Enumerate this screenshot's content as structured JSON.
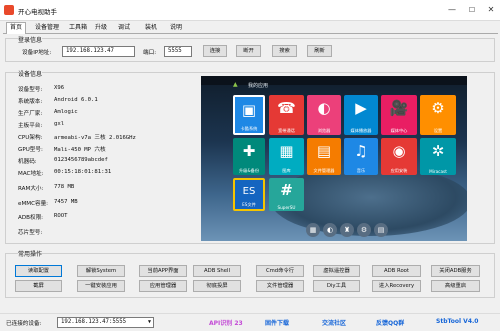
{
  "window": {
    "title": "开心电视助手",
    "minimize": "—",
    "maximize": "☐",
    "close": "✕"
  },
  "tabs": [
    "首页",
    "设备管理",
    "工具箱",
    "升级",
    "调试",
    "装机",
    "说明"
  ],
  "login": {
    "group_title": "登录信息",
    "ip_label": "设备IP地址:",
    "ip_value": "192.168.123.47",
    "port_label": "端口:",
    "port_value": "5555",
    "connect": "连接",
    "disconnect": "断开",
    "search": "搜索",
    "refresh": "刷新"
  },
  "device": {
    "group_title": "设备信息",
    "rows": [
      {
        "label": "设备型号:",
        "value": "X96"
      },
      {
        "label": "系统版本:",
        "value": "Android 6.0.1"
      },
      {
        "label": "生产厂家:",
        "value": "Amlogic"
      },
      {
        "label": "主板平台:",
        "value": "gxl"
      },
      {
        "label": "CPU架构:",
        "value": "armeabi-v7a 三核 2.016GHz"
      },
      {
        "label": "GPU型号:",
        "value": "Mali-450 MP 六核"
      },
      {
        "label": "机器码:",
        "value": "0123456789abcdef"
      },
      {
        "label": "MAC地址:",
        "value": "00:15:18:01:81:31"
      },
      {
        "label": "RAM大小:",
        "value": "778 MB"
      },
      {
        "label": "eMMC容量:",
        "value": "7457 MB"
      },
      {
        "label": "ADB权限:",
        "value": "ROOT"
      },
      {
        "label": "芯片型号:",
        "value": ""
      }
    ]
  },
  "screen": {
    "header": "我的应用",
    "apps_row1": [
      {
        "name": "卡酷系统",
        "icon": "▣",
        "color": "#1e88e5"
      },
      {
        "name": "宽带通话",
        "icon": "☎",
        "color": "#e53935"
      },
      {
        "name": "浏览器",
        "icon": "◐",
        "color": "#ec407a"
      },
      {
        "name": "媒体播放器",
        "icon": "▶",
        "color": "#0288d1"
      },
      {
        "name": "媒体中心",
        "icon": "🎥",
        "color": "#e91e63"
      },
      {
        "name": "设置",
        "icon": "⚙",
        "color": "#ff8f00"
      }
    ],
    "apps_row2": [
      {
        "name": "升级&备份",
        "icon": "✚",
        "color": "#00897b"
      },
      {
        "name": "图库",
        "icon": "▦",
        "color": "#00acc1"
      },
      {
        "name": "文件管理器",
        "icon": "▤",
        "color": "#f57c00"
      },
      {
        "name": "音乐",
        "icon": "♫",
        "color": "#1e88e5"
      },
      {
        "name": "应用安装",
        "icon": "◉",
        "color": "#e53935"
      },
      {
        "name": "Miracast",
        "icon": "✲",
        "color": "#0097a7"
      }
    ],
    "apps_row3": [
      {
        "name": "ES文件",
        "icon": "ES",
        "color": "#1565c0"
      },
      {
        "name": "SuperSU",
        "icon": "#",
        "color": "#26a69a"
      }
    ],
    "dock": [
      "▦",
      "◐",
      "♜",
      "⚙",
      "▤"
    ]
  },
  "ops": {
    "group_title": "常用操作",
    "row1": [
      "读取配置",
      "解锁System",
      "当前APP界面",
      "ADB Shell",
      "Cmd命令行",
      "虚拟遥控器",
      "ADB Root",
      "关闭ADB服务"
    ],
    "row2": [
      "截屏",
      "一键安装应用",
      "应用管理器",
      "彻底投屏",
      "文件管理器",
      "Diy工具",
      "进入Recovery",
      "高级重启"
    ]
  },
  "statusbar": {
    "device_label": "已连接的设备:",
    "device_value": "192.168.123.47:5555",
    "links": [
      "API识别 23",
      "固件下载",
      "交流社区",
      "反馈QQ群",
      "StbTool V4.0"
    ],
    "link_colors": [
      "#c34bd6",
      "#1565d8",
      "#1565d8",
      "#1565d8",
      "#1565d8"
    ]
  }
}
